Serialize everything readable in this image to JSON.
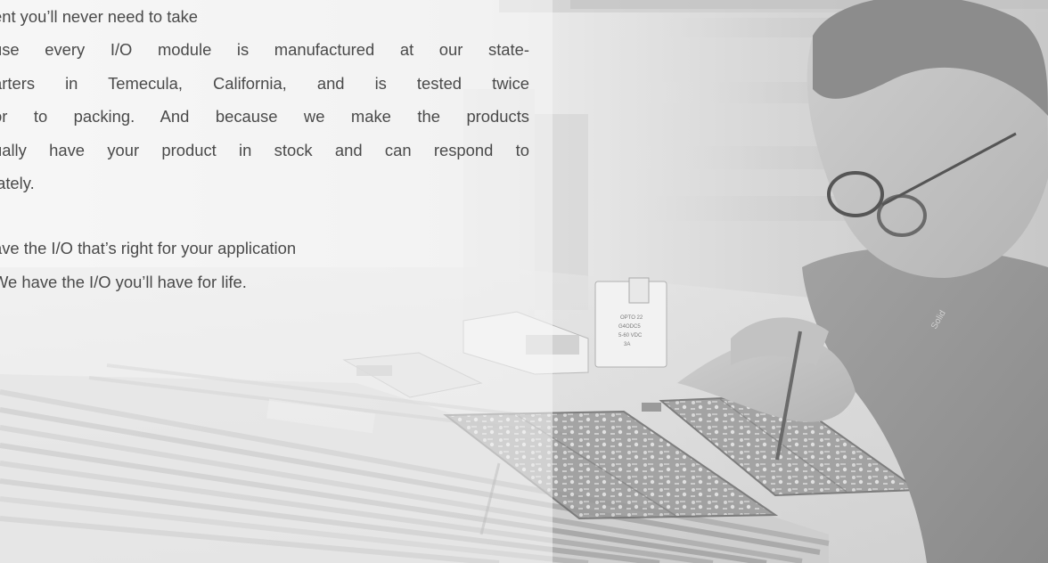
{
  "body_text": {
    "paragraph_1": [
      "ent you’ll never need to take",
      "use every I/O module is manufactured at our state-",
      "arters in Temecula, California, and is tested twice",
      "or to packing. And because we make the products",
      "ually have your product in stock and can respond to",
      "iately."
    ],
    "paragraph_2": [
      "ave the I/O that’s right for your application",
      " We have the I/O you’ll have for life."
    ]
  },
  "photo": {
    "description_icon": "technician-soldering-circuit-boards-photo",
    "board_label_lines": [
      "OPTO 22",
      "G4ODC5",
      "5-60 VDC",
      "3A"
    ]
  },
  "colors": {
    "text": "#4a4a4a",
    "background": "#f4f4f4"
  }
}
